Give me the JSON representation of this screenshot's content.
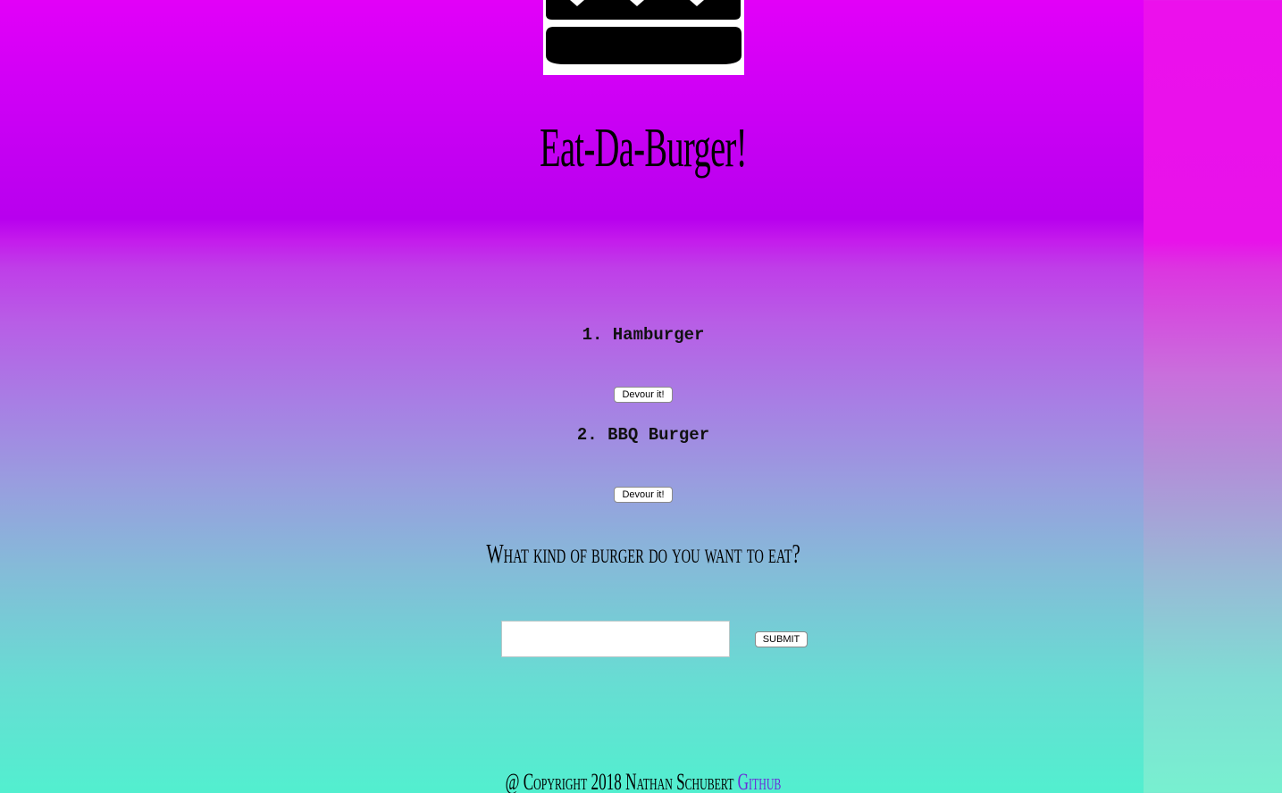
{
  "page": {
    "title": "Eat-Da-Burger!",
    "logo_icon": "burger-icon"
  },
  "burgers": [
    {
      "label": "1. Hamburger",
      "button_label": "Devour it!"
    },
    {
      "label": "2. BBQ Burger",
      "button_label": "Devour it!"
    }
  ],
  "form": {
    "question": "What kind of burger do you want to eat?",
    "input_value": "",
    "submit_label": "SUBMIT"
  },
  "footer": {
    "copyright": "@ Copyright 2018 Nathan Schubert",
    "link_label": "Github"
  },
  "colors": {
    "top_magenta": "#e200f8",
    "bottom_teal": "#52efcf",
    "link": "#6a2bd8"
  }
}
